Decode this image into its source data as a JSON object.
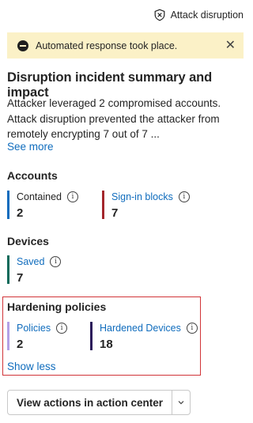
{
  "header": {
    "tag_label": "Attack disruption",
    "tag_icon": "shield-x-icon"
  },
  "banner": {
    "message": "Automated response took place.",
    "icon": "stop-circle-icon",
    "close_glyph": "✕"
  },
  "summary": {
    "title": "Disruption incident summary and impact",
    "description": "Attacker leveraged 2 compromised accounts. Attack disruption prevented the attacker from remotely encrypting 7 out of 7 ...",
    "see_more": "See more"
  },
  "accounts": {
    "title": "Accounts",
    "metrics": [
      {
        "label": "Contained",
        "value": "2",
        "color": "#0f6cbd",
        "link": false
      },
      {
        "label": "Sign-in blocks",
        "value": "7",
        "color": "#a4262c",
        "link": true
      }
    ]
  },
  "devices": {
    "title": "Devices",
    "metrics": [
      {
        "label": "Saved",
        "value": "7",
        "color": "#0b6a5a",
        "link": true
      }
    ]
  },
  "hardening": {
    "title": "Hardening policies",
    "metrics": [
      {
        "label": "Policies",
        "value": "2",
        "color": "#b4a0e6",
        "link": true
      },
      {
        "label": "Hardened Devices",
        "value": "18",
        "color": "#2b1b5a",
        "link": true
      }
    ],
    "show_less": "Show less"
  },
  "action": {
    "label": "View actions in action center",
    "split_icon": "chevron-down-icon"
  }
}
